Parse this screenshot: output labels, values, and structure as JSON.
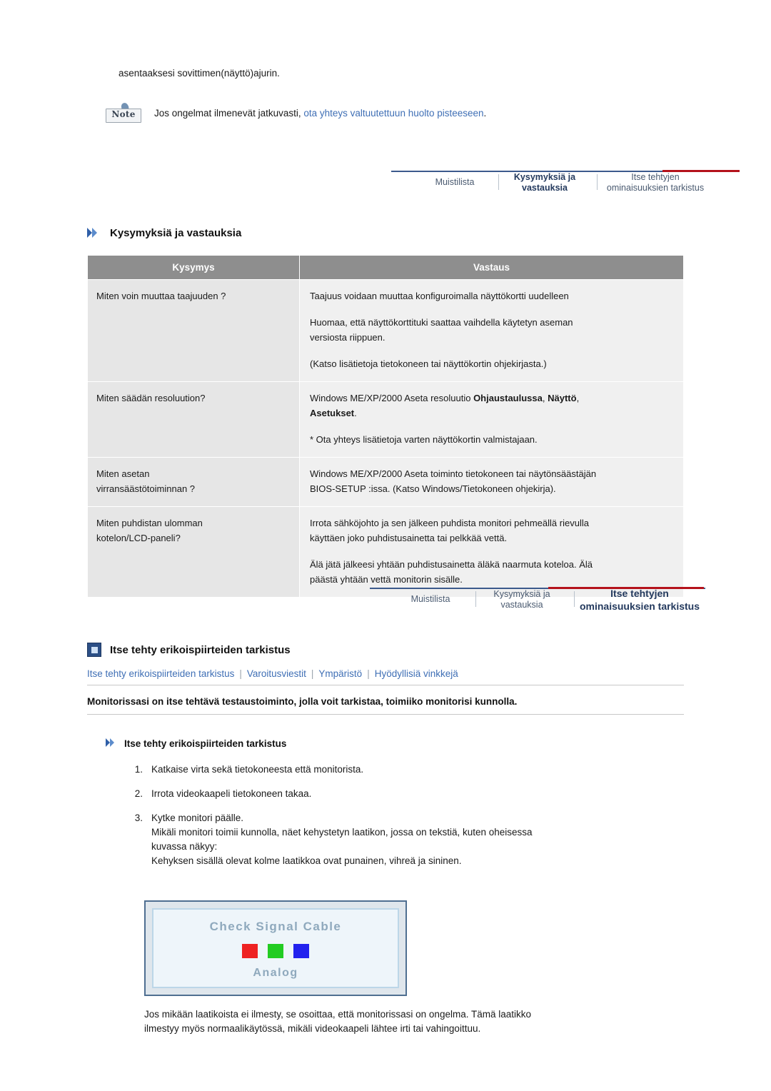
{
  "top": {
    "line1": "asentaaksesi sovittimen(näyttö)ajurin.",
    "note_icon_label": "Note",
    "note_text_prefix": "Jos ongelmat ilmenevät jatkuvasti, ",
    "note_link": "ota yhteys valtuutettuun huolto pisteeseen",
    "note_text_suffix": "."
  },
  "banner1": {
    "tab1": "Muistilista",
    "tab2_line1": "Kysymyksiä ja",
    "tab2_line2": "vastauksia",
    "tab3_line1": "Itse tehtyjen",
    "tab3_line2": "ominaisuuksien tarkistus"
  },
  "banner2": {
    "tab1": "Muistilista",
    "tab2_line1": "Kysymyksiä ja",
    "tab2_line2": "vastauksia",
    "tab3_line1": "Itse tehtyjen",
    "tab3_line2": "ominaisuuksien tarkistus"
  },
  "qa": {
    "heading": "Kysymyksiä ja vastauksia",
    "col1": "Kysymys",
    "col2": "Vastaus",
    "rows": [
      {
        "q": "Miten voin muuttaa taajuuden ?",
        "a1": "Taajuus voidaan muuttaa konfiguroimalla näyttökortti uudelleen",
        "a2": "Huomaa, että näyttökorttituki saattaa vaihdella käytetyn aseman\nversiosta riippuen.",
        "a3": "(Katso lisätietoja tietokoneen tai näyttökortin ohjekirjasta.)"
      },
      {
        "q": "Miten säädän resoluution?",
        "a1_pre": "Windows ME/XP/2000 Aseta resoluutio ",
        "a1_b1": "Ohjaustaulussa",
        "a1_mid": ", ",
        "a1_b2": "Näyttö",
        "a1_post": ",",
        "a1_b3": "Asetukset",
        "a1_end": ".",
        "a2": "* Ota yhteys lisätietoja varten näyttökortin valmistajaan."
      },
      {
        "q": "Miten asetan\nvirransäästötoiminnan ?",
        "a1": "Windows ME/XP/2000 Aseta toiminto tietokoneen tai näytönsäästäjän\nBIOS-SETUP :issa. (Katso Windows/Tietokoneen ohjekirja)."
      },
      {
        "q": "Miten puhdistan ulomman\nkotelon/LCD-paneli?",
        "a1": "Irrota sähköjohto ja sen jälkeen puhdista monitori pehmeällä rievulla\nkäyttäen joko puhdistusainetta tai pelkkää vettä.",
        "a2": "Älä jätä jälkeesi yhtään puhdistusainetta äläkä naarmuta koteloa. Älä\npäästä yhtään vettä monitorin sisälle."
      }
    ]
  },
  "selftest": {
    "heading": "Itse tehty erikoispiirteiden tarkistus",
    "links": [
      "Itse tehty erikoispiirteiden tarkistus",
      "Varoitusviestit",
      "Ympäristö",
      "Hyödyllisiä vinkkejä"
    ],
    "bold_line": "Monitorissasi on itse tehtävä testaustoiminto, jolla voit tarkistaa, toimiiko monitorisi kunnolla.",
    "sub_heading": "Itse tehty erikoispiirteiden tarkistus",
    "steps": [
      {
        "num": "1.",
        "text": "Katkaise virta sekä tietokoneesta että monitorista."
      },
      {
        "num": "2.",
        "text": "Irrota videokaapeli tietokoneen takaa."
      },
      {
        "num": "3.",
        "text": "Kytke monitori päälle.\nMikäli monitori toimii kunnolla, näet kehystetyn laatikon, jossa on tekstiä, kuten oheisessa\nkuvassa näkyy:\nKehyksen sisällä olevat kolme laatikkoa ovat punainen, vihreä ja sininen."
      }
    ],
    "test_image": {
      "title": "Check Signal Cable",
      "subtitle": "Analog",
      "swatch_colors": [
        "#ee2222",
        "#22cc22",
        "#2222ee"
      ]
    },
    "closing": "Jos mikään laatikoista ei ilmesty, se osoittaa, että monitorissasi on ongelma. Tämä laatikko\nilmestyy myös normaalikäytössä, mikäli videokaapeli lähtee irti tai vahingoittuu."
  }
}
